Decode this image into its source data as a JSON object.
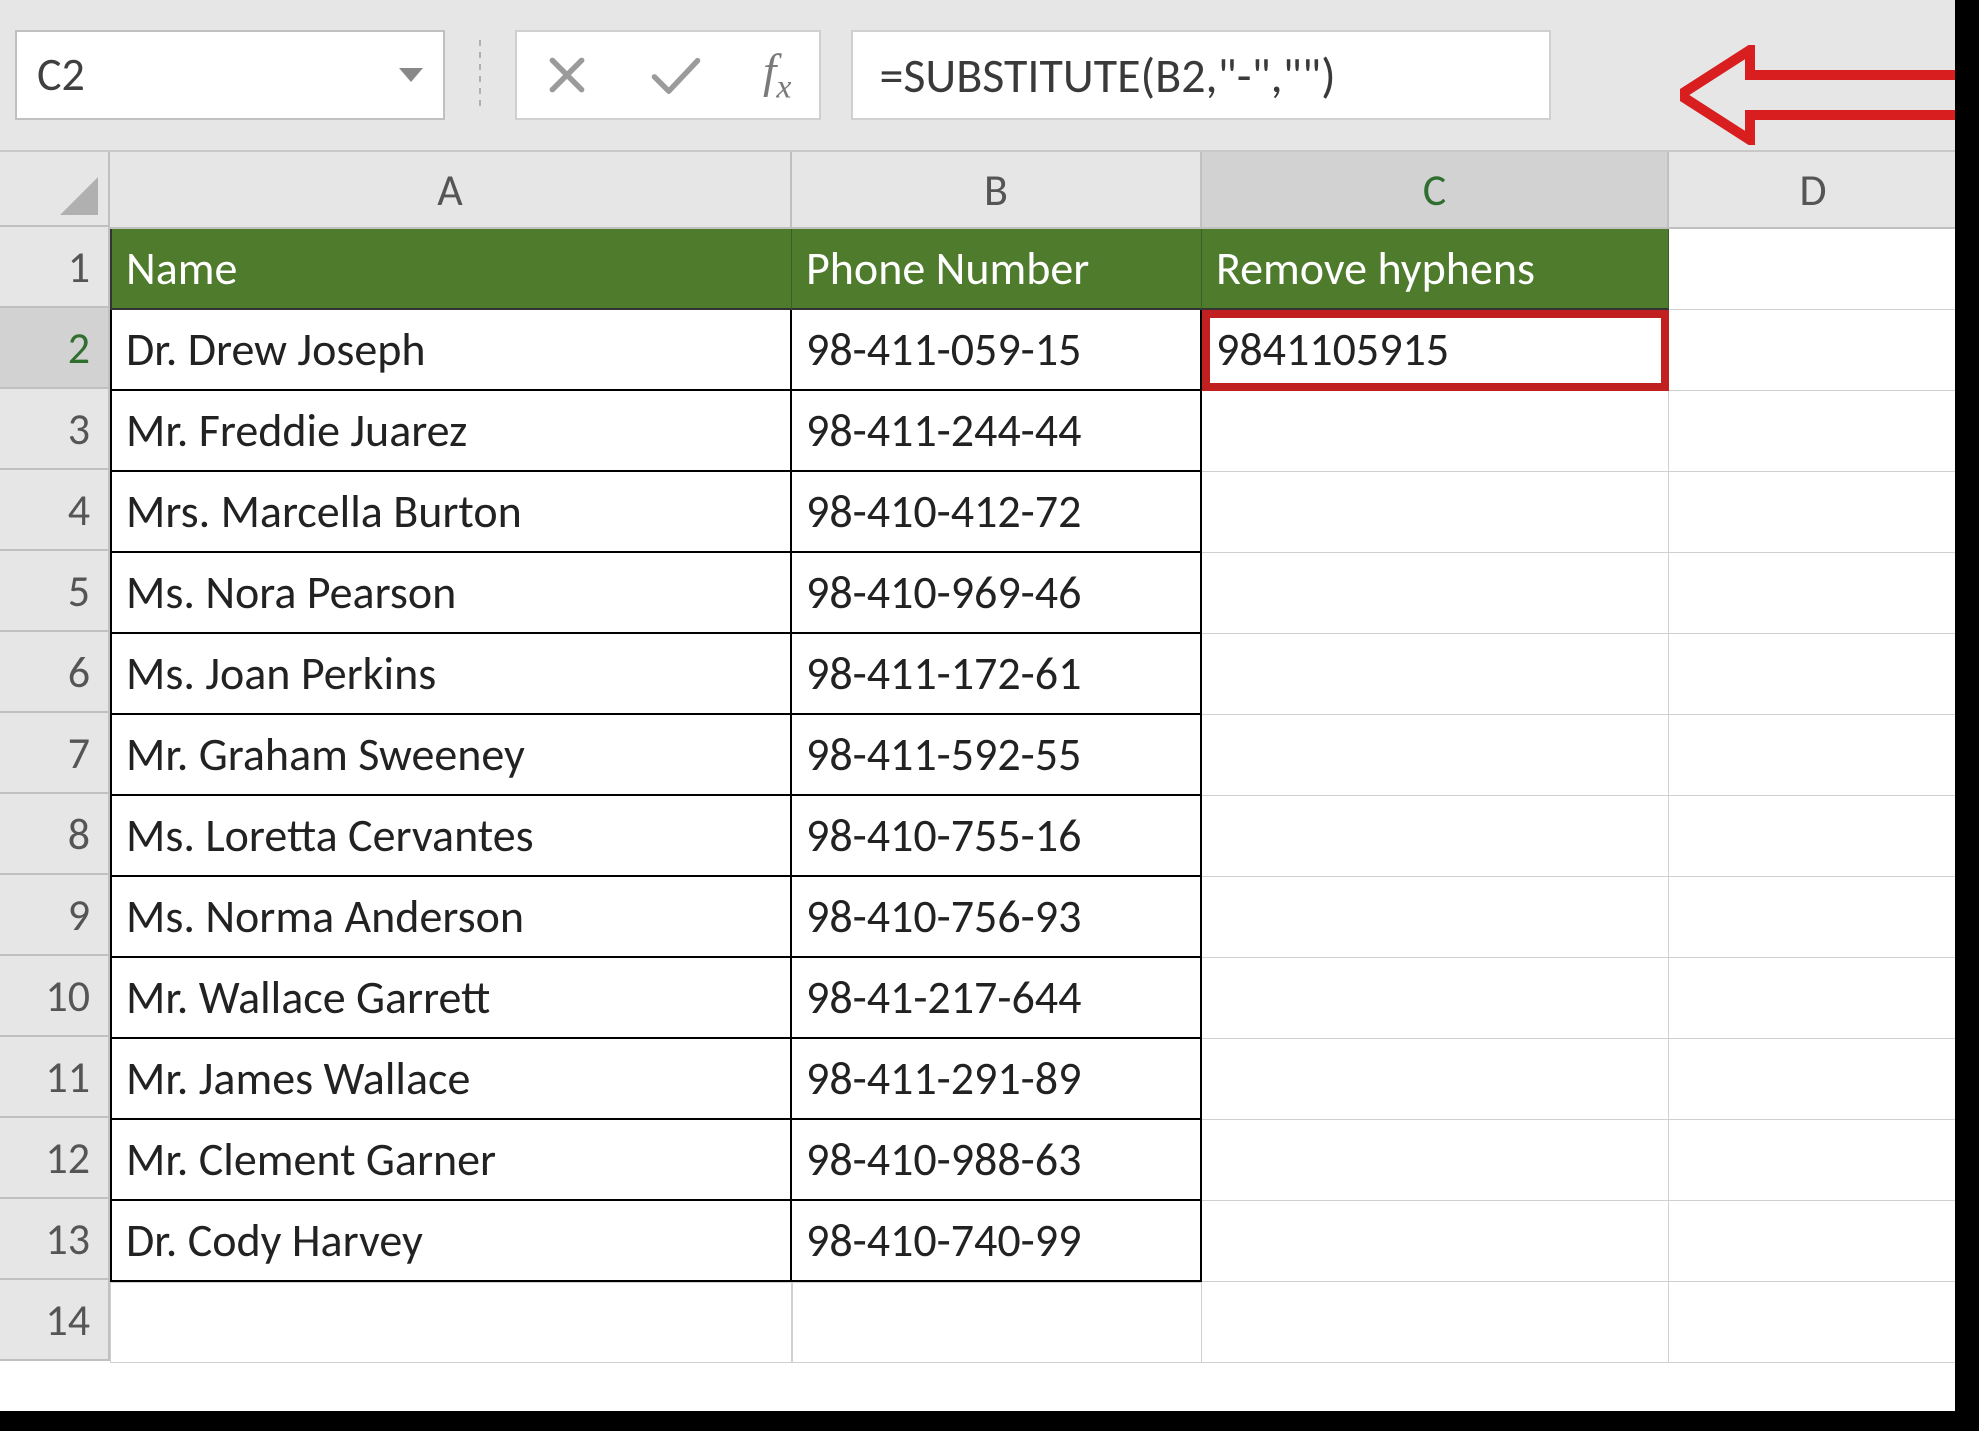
{
  "formula_bar": {
    "cell_ref": "C2",
    "formula": "=SUBSTITUTE(B2,\"-\",\"\")"
  },
  "columns": {
    "A": "A",
    "B": "B",
    "C": "C",
    "D": "D"
  },
  "headers": {
    "A": "Name",
    "B": "Phone Number",
    "C": "Remove hyphens"
  },
  "row_labels": [
    "1",
    "2",
    "3",
    "4",
    "5",
    "6",
    "7",
    "8",
    "9",
    "10",
    "11",
    "12",
    "13",
    "14"
  ],
  "rows": [
    {
      "name": "Dr. Drew Joseph",
      "phone": "98-411-059-15",
      "result": "9841105915"
    },
    {
      "name": "Mr. Freddie Juarez",
      "phone": "98-411-244-44",
      "result": ""
    },
    {
      "name": "Mrs. Marcella Burton",
      "phone": "98-410-412-72",
      "result": ""
    },
    {
      "name": "Ms. Nora Pearson",
      "phone": "98-410-969-46",
      "result": ""
    },
    {
      "name": "Ms. Joan Perkins",
      "phone": "98-411-172-61",
      "result": ""
    },
    {
      "name": "Mr. Graham Sweeney",
      "phone": "98-411-592-55",
      "result": ""
    },
    {
      "name": "Ms. Loretta Cervantes",
      "phone": "98-410-755-16",
      "result": ""
    },
    {
      "name": "Ms. Norma Anderson",
      "phone": "98-410-756-93",
      "result": ""
    },
    {
      "name": "Mr. Wallace Garrett",
      "phone": "98-41-217-644",
      "result": ""
    },
    {
      "name": "Mr. James Wallace",
      "phone": "98-411-291-89",
      "result": ""
    },
    {
      "name": "Mr. Clement Garner",
      "phone": "98-410-988-63",
      "result": ""
    },
    {
      "name": "Dr. Cody Harvey",
      "phone": "98-410-740-99",
      "result": ""
    }
  ],
  "selection": {
    "active_cell": "C2",
    "active_row": 2,
    "active_col": "C"
  },
  "annotations": {
    "c2_highlight": true,
    "arrow_to_formula": true
  }
}
